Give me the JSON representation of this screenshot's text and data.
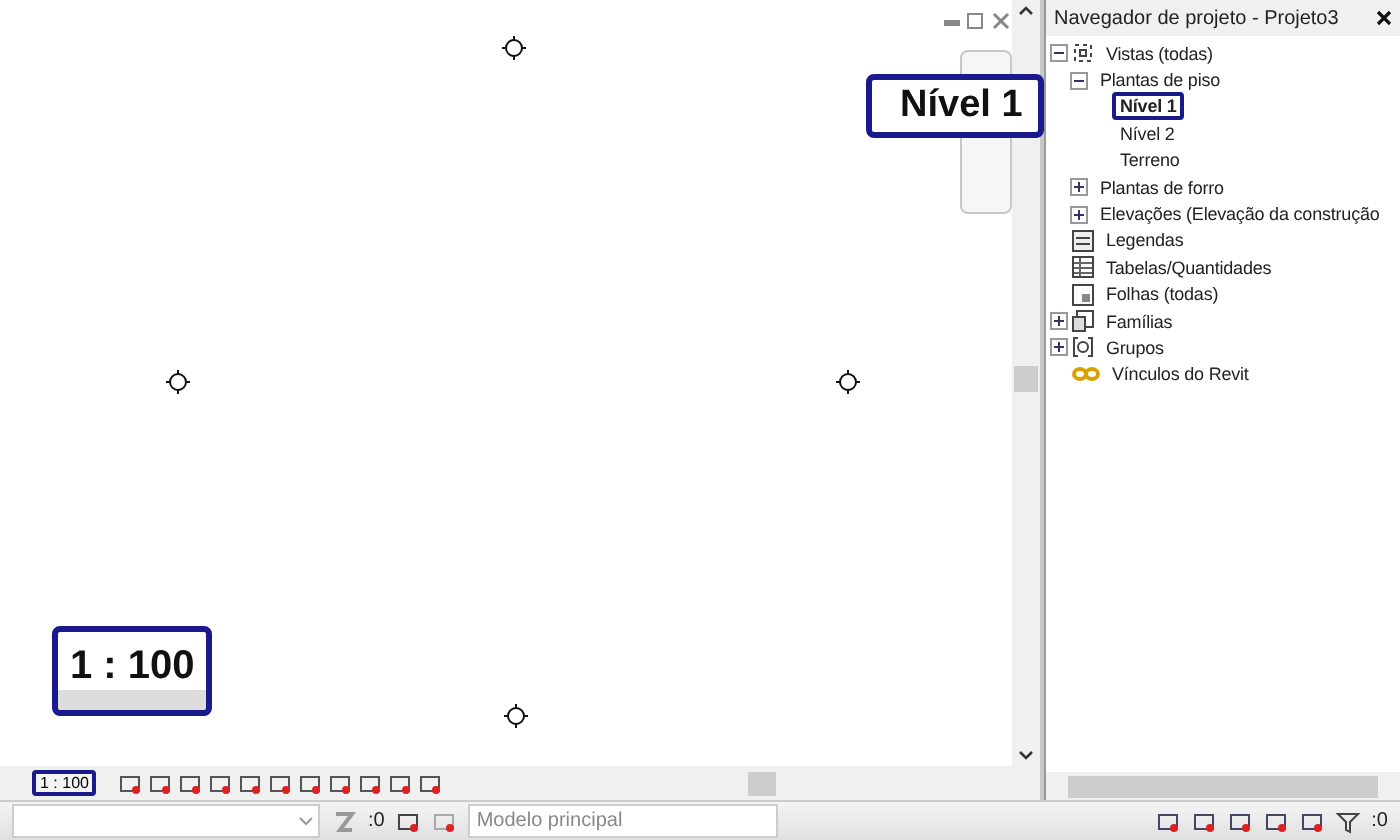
{
  "view": {
    "callouts": [
      {
        "kind": "level",
        "text": "Nível 1"
      },
      {
        "kind": "scale",
        "text": "1 : 100"
      }
    ]
  },
  "view_bar": {
    "scale": "1 : 100"
  },
  "browser": {
    "title": "Navegador de projeto - Projeto3",
    "tree": [
      {
        "label": "Vistas (todas)",
        "kind": "views",
        "expanded": true,
        "children": [
          {
            "label": "Plantas de piso",
            "expanded": true,
            "children": [
              {
                "label": "Nível 1",
                "selected": true
              },
              {
                "label": "Nível 2",
                "selected": false
              },
              {
                "label": "Terreno",
                "selected": false
              }
            ]
          },
          {
            "label": "Plantas de forro",
            "expanded": false
          },
          {
            "label": "Elevações (Elevação da construção",
            "expanded": false
          }
        ]
      },
      {
        "label": "Legendas",
        "kind": "legend"
      },
      {
        "label": "Tabelas/Quantidades",
        "kind": "schedule"
      },
      {
        "label": "Folhas (todas)",
        "kind": "sheet"
      },
      {
        "label": "Famílias",
        "kind": "family",
        "expanded": false
      },
      {
        "label": "Grupos",
        "kind": "group",
        "expanded": false
      },
      {
        "label": "Vínculos do Revit",
        "kind": "link"
      }
    ]
  },
  "status_bar": {
    "selection_count": ":0",
    "model": "Modelo principal",
    "filter_count": ":0"
  }
}
